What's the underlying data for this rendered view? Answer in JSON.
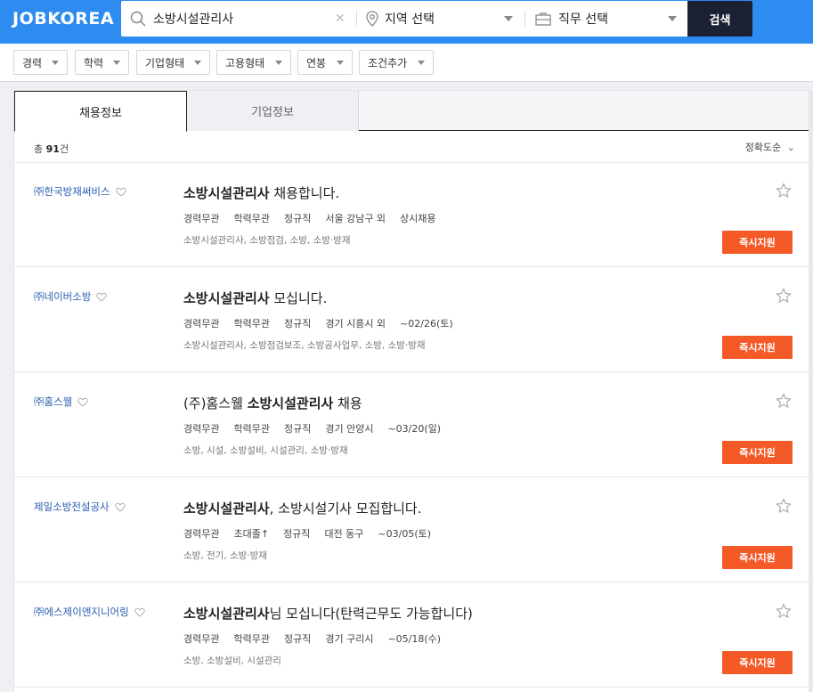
{
  "header": {
    "logo": "JOBKOREA",
    "search_value": "소방시설관리사",
    "region_label": "지역 선택",
    "job_label": "직무 선택",
    "search_button": "검색"
  },
  "filters": [
    "경력",
    "학력",
    "기업형태",
    "고용형태",
    "연봉",
    "조건추가"
  ],
  "tabs": {
    "active": "채용정보",
    "inactive": "기업정보"
  },
  "summary": {
    "prefix": "총",
    "count": "91",
    "suffix": "건"
  },
  "sort_label": "정확도순",
  "apply_label": "즉시지원",
  "jobs": [
    {
      "company": "㈜한국방재써비스",
      "title_bold": "소방시설관리사",
      "title_rest": " 채용합니다.",
      "meta": [
        "경력무관",
        "학력무관",
        "정규직",
        "서울 강남구 외",
        "상시채용"
      ],
      "tags": "소방시설관리사, 소방점검, 소방, 소방·방재"
    },
    {
      "company": "㈜네이버소방",
      "title_bold": "소방시설관리사",
      "title_rest": " 모십니다.",
      "meta": [
        "경력무관",
        "학력무관",
        "정규직",
        "경기 시흥시 외",
        "~02/26(토)"
      ],
      "tags": "소방시설관리사, 소방점검보조, 소방공사업무, 소방, 소방·방재"
    },
    {
      "company": "㈜홈스웰",
      "title_pre": "(주)홈스웰 ",
      "title_bold": "소방시설관리사",
      "title_rest": " 채용",
      "meta": [
        "경력무관",
        "학력무관",
        "정규직",
        "경기 안양시",
        "~03/20(일)"
      ],
      "tags": "소방, 시설, 소방설비, 시설관리, 소방·방재"
    },
    {
      "company": "제일소방전설공사",
      "title_bold": "소방시설관리사",
      "title_rest": ", 소방시설기사 모집합니다.",
      "meta": [
        "경력무관",
        "초대졸↑",
        "정규직",
        "대전 동구",
        "~03/05(토)"
      ],
      "tags": "소방, 전기, 소방·방재"
    },
    {
      "company": "㈜에스제이엔지니어링",
      "title_bold": "소방시설관리사",
      "title_rest": "님 모십니다(탄력근무도 가능합니다)",
      "meta": [
        "경력무관",
        "학력무관",
        "정규직",
        "경기 구리시",
        "~05/18(수)"
      ],
      "tags": "소방, 소방설비, 시설관리"
    }
  ]
}
